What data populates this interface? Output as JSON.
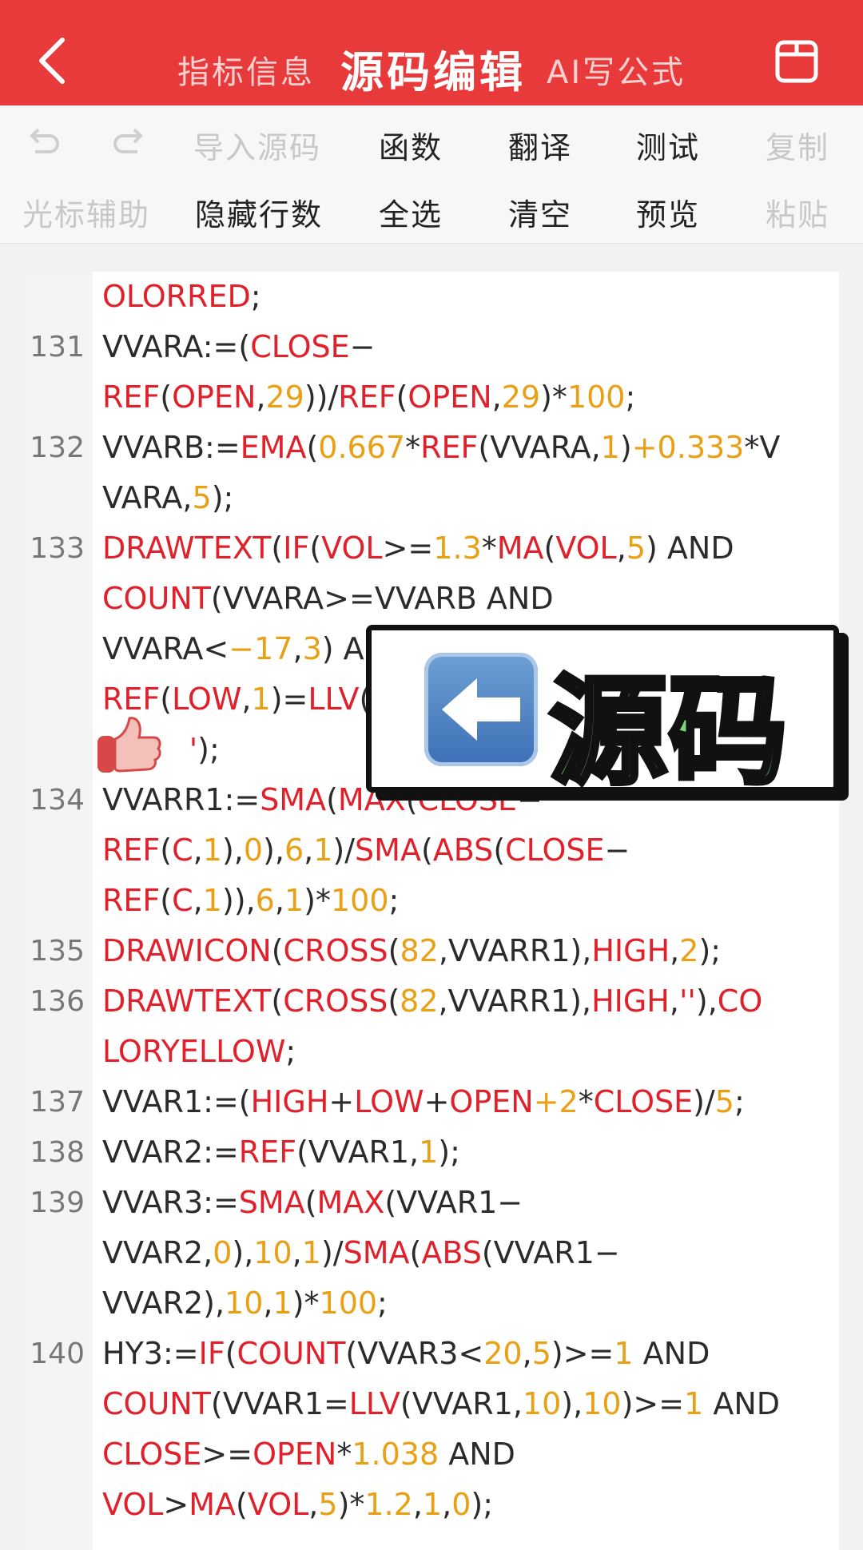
{
  "header": {
    "tabs": [
      {
        "label": "指标信息"
      },
      {
        "label": "源码编辑",
        "active": true
      },
      {
        "label": "AI写公式"
      }
    ],
    "accent": "#e83a3a"
  },
  "toolbar": {
    "row1": {
      "undo_icon": "undo-icon",
      "redo_icon": "redo-icon",
      "import": "导入源码",
      "functions": "函数",
      "translate": "翻译",
      "test": "测试",
      "copy": "复制"
    },
    "row2": {
      "cursor_assist": "光标辅助",
      "hide_line_numbers": "隐藏行数",
      "select_all": "全选",
      "clear": "清空",
      "preview": "预览",
      "paste": "粘贴"
    }
  },
  "editor": {
    "lines": [
      {
        "n": "",
        "html": "<span class='k'>OLORRED</span>;"
      },
      {
        "n": "131",
        "html": "VVARA:=(<span class='k'>CLOSE</span>−"
      },
      {
        "n": "",
        "html": "<span class='k'>REF</span>(<span class='k'>OPEN</span>,<span class='n'>29</span>))/<span class='k'>REF</span>(<span class='k'>OPEN</span>,<span class='n'>29</span>)*<span class='n'>100</span>;"
      },
      {
        "n": "132",
        "html": "VVARB:=<span class='k'>EMA</span>(<span class='n'>0.667</span>*<span class='k'>REF</span>(VVARA,<span class='n'>1</span>)<span class='n'>+0.333</span>*V"
      },
      {
        "n": "",
        "html": "VARA,<span class='n'>5</span>);"
      },
      {
        "n": "133",
        "html": "<span class='k'>DRAWTEXT</span>(<span class='k'>IF</span>(<span class='k'>VOL</span>&gt;=<span class='n'>1.3</span>*<span class='k'>MA</span>(<span class='k'>VOL</span>,<span class='n'>5</span>) AND"
      },
      {
        "n": "",
        "html": "<span class='k'>COUNT</span>(VVARA&gt;=VVARB AND"
      },
      {
        "n": "",
        "html": "VVARA&lt;<span class='n'>−17</span>,<span class='n'>3</span>) AND"
      },
      {
        "n": "",
        "html": "<span class='k'>REF</span>(<span class='k'>LOW</span>,<span class='n'>1</span>)=<span class='k'>LLV</span>("
      },
      {
        "n": "",
        "html": "&nbsp;&nbsp;&nbsp;&nbsp;&nbsp;&nbsp;&nbsp;&nbsp;&nbsp;<span class='k'>'</span>);"
      },
      {
        "n": "134",
        "html": "VVARR1:=<span class='k'>SMA</span>(<span class='k'>MAX</span>(<span class='k'>CLOSE</span>−"
      },
      {
        "n": "",
        "html": "<span class='k'>REF</span>(<span class='k'>C</span>,<span class='n'>1</span>),<span class='n'>0</span>),<span class='n'>6</span>,<span class='n'>1</span>)/<span class='k'>SMA</span>(<span class='k'>ABS</span>(<span class='k'>CLOSE</span>−"
      },
      {
        "n": "",
        "html": "<span class='k'>REF</span>(<span class='k'>C</span>,<span class='n'>1</span>)),<span class='n'>6</span>,<span class='n'>1</span>)*<span class='n'>100</span>;"
      },
      {
        "n": "135",
        "html": "<span class='k'>DRAWICON</span>(<span class='k'>CROSS</span>(<span class='n'>82</span>,VVARR1),<span class='k'>HIGH</span>,<span class='n'>2</span>);"
      },
      {
        "n": "136",
        "html": "<span class='k'>DRAWTEXT</span>(<span class='k'>CROSS</span>(<span class='n'>82</span>,VVARR1),<span class='k'>HIGH</span>,<span class='k'>''</span>),<span class='k'>CO</span>"
      },
      {
        "n": "",
        "html": "<span class='k'>LORYELLOW</span>;"
      },
      {
        "n": "137",
        "html": "VVAR1:=(<span class='k'>HIGH</span>+<span class='k'>LOW</span>+<span class='k'>OPEN</span><span class='n'>+2</span>*<span class='k'>CLOSE</span>)/<span class='n'>5</span>;"
      },
      {
        "n": "138",
        "html": "VVAR2:=<span class='k'>REF</span>(VVAR1,<span class='n'>1</span>);"
      },
      {
        "n": "139",
        "html": "VVAR3:=<span class='k'>SMA</span>(<span class='k'>MAX</span>(VVAR1−"
      },
      {
        "n": "",
        "html": "VVAR2,<span class='n'>0</span>),<span class='n'>10</span>,<span class='n'>1</span>)/<span class='k'>SMA</span>(<span class='k'>ABS</span>(VVAR1−"
      },
      {
        "n": "",
        "html": "VVAR2),<span class='n'>10</span>,<span class='n'>1</span>)*<span class='n'>100</span>;"
      },
      {
        "n": "140",
        "html": "HY3:=<span class='k'>IF</span>(<span class='k'>COUNT</span>(VVAR3&lt;<span class='n'>20</span>,<span class='n'>5</span>)&gt;=<span class='n'>1</span> AND"
      },
      {
        "n": "",
        "html": "<span class='k'>COUNT</span>(VVAR1=<span class='k'>LLV</span>(VVAR1,<span class='n'>10</span>),<span class='n'>10</span>)&gt;=<span class='n'>1</span> AND"
      },
      {
        "n": "",
        "html": "<span class='k'>CLOSE</span>&gt;=<span class='k'>OPEN</span>*<span class='n'>1.038</span> AND"
      },
      {
        "n": "",
        "html": "<span class='k'>VOL</span>&gt;<span class='k'>MA</span>(<span class='k'>VOL</span>,<span class='n'>5</span>)*<span class='n'>1.2</span>,<span class='n'>1</span>,<span class='n'>0</span>);"
      }
    ]
  },
  "overlay": {
    "sticker_text": "源码",
    "sticker_icon": "left-arrow-emoji-icon",
    "thumb_icon": "thumbs-up-icon"
  },
  "colors": {
    "keyword": "#e0202a",
    "number": "#e9a015",
    "plain": "#2b2b2b"
  }
}
